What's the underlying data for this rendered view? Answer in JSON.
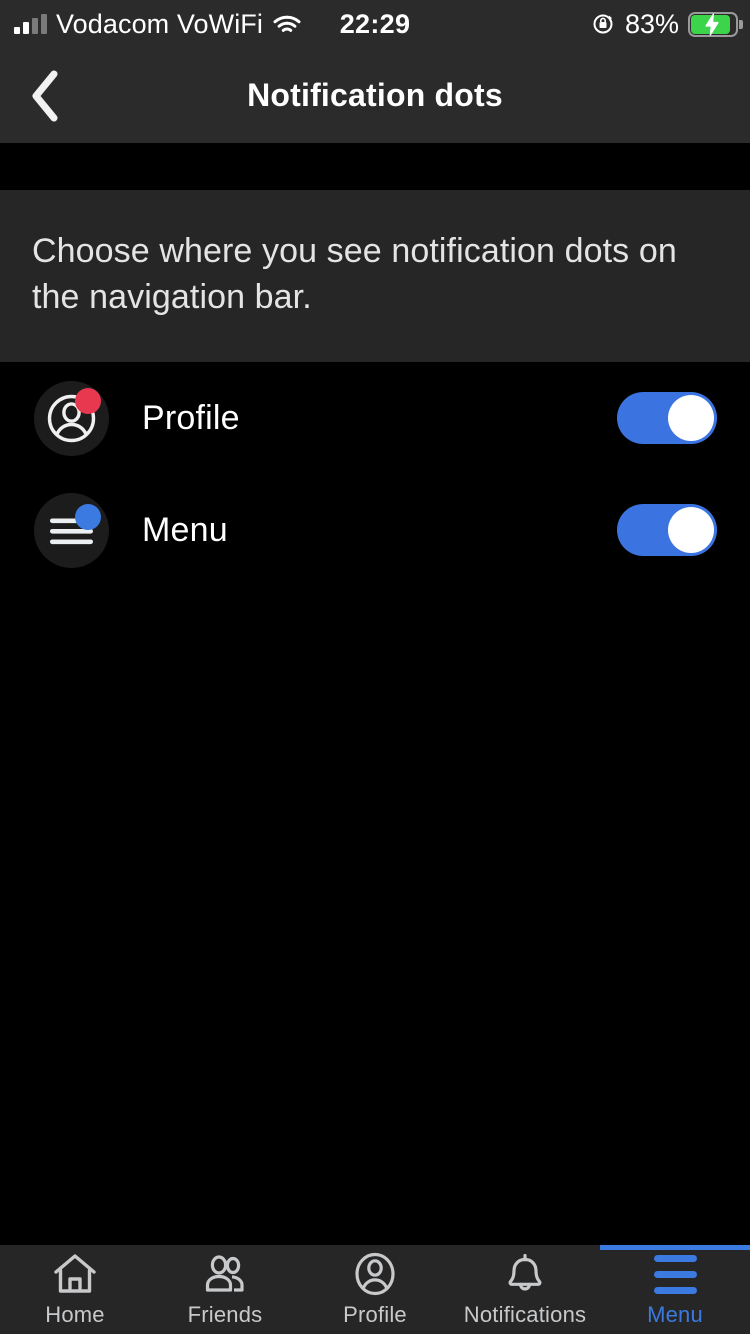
{
  "status_bar": {
    "carrier": "Vodacom VoWiFi",
    "time": "22:29",
    "battery_percent": "83%",
    "signal_bars_filled": 2,
    "signal_bars_total": 4,
    "wifi_icon": "wifi-icon",
    "rotation_lock_icon": "rotation-lock-icon",
    "battery_icon": "battery-charging-icon",
    "battery_color": "#3bd44a"
  },
  "header": {
    "back_icon": "chevron-left-icon",
    "title": "Notification dots"
  },
  "description": {
    "text": "Choose where you see notification dots on the navigation bar."
  },
  "settings": {
    "rows": [
      {
        "label": "Profile",
        "icon": "profile-avatar-icon",
        "badge_color": "#e8384f",
        "toggle_on": true
      },
      {
        "label": "Menu",
        "icon": "hamburger-menu-icon",
        "badge_color": "#3b7ae0",
        "toggle_on": true
      }
    ]
  },
  "bottom_nav": {
    "active_color": "#3b7ae0",
    "inactive_color": "#c8c9cb",
    "tabs": [
      {
        "label": "Home",
        "icon": "home-icon",
        "active": false
      },
      {
        "label": "Friends",
        "icon": "friends-icon",
        "active": false
      },
      {
        "label": "Profile",
        "icon": "profile-icon",
        "active": false
      },
      {
        "label": "Notifications",
        "icon": "bell-icon",
        "active": false
      },
      {
        "label": "Menu",
        "icon": "hamburger-icon",
        "active": true
      }
    ]
  }
}
